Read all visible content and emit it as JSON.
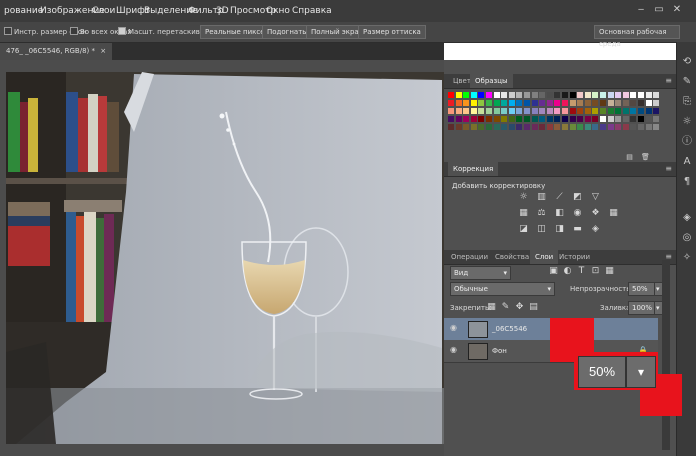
{
  "menubar": {
    "items": [
      "рование",
      "Изображение",
      "Слои",
      "Шрифт",
      "Выделение",
      "Фильтр",
      "3D",
      "Просмотр",
      "Окно",
      "Справка"
    ]
  },
  "options_bar": {
    "checks": [
      "Инстр. размер окон",
      "Во всех окнах",
      "Масшт. перетаскиванием"
    ],
    "buttons": [
      "Реальные пикселы",
      "Подогнать",
      "Полный экран",
      "Размер оттиска"
    ],
    "workspace": "Основная рабочая среда"
  },
  "document": {
    "tab_label": "476_ _06C5546, RGB/8) *",
    "tab_close": "×"
  },
  "swatches_panel": {
    "tabs": [
      "Цвет",
      "Образцы"
    ],
    "active_tab": "Образцы"
  },
  "correction_panel": {
    "tab": "Коррекция",
    "title": "Добавить корректировку"
  },
  "layers_panel": {
    "tabs": [
      "Операции",
      "Свойства",
      "Слои",
      "Истории"
    ],
    "active_tab": "Слои",
    "filter_kind": "Вид",
    "blend_mode": "Обычные",
    "opacity_label": "Непрозрачность:",
    "opacity_value": "50%",
    "lock_label": "Закрепить:",
    "fill_label": "Заливка:",
    "fill_value": "100%",
    "layers": [
      {
        "name": "_06C5546"
      },
      {
        "name": "Фон"
      }
    ]
  },
  "zoom_callout": {
    "value": "50%",
    "arrow": "▾"
  },
  "colors": {
    "highlight_red": "#e8131c",
    "panel_bg": "#505050",
    "menubar_bg": "#3b3b3b"
  },
  "icons": [
    "visibility-eye-icon",
    "lock-icon",
    "dropdown-arrow-icon",
    "panel-menu-icon"
  ]
}
